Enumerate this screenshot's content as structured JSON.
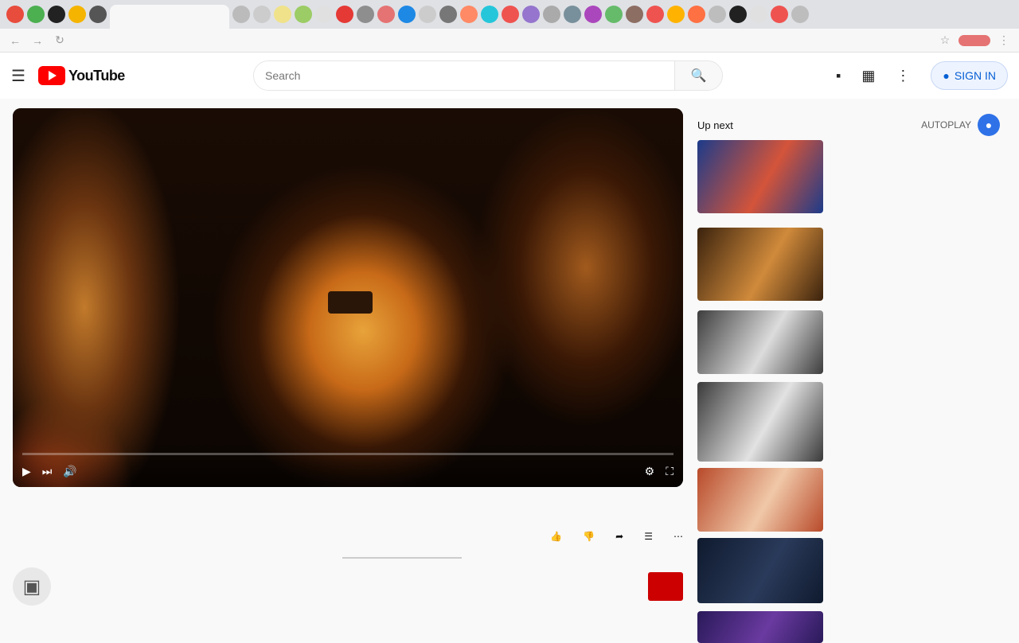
{
  "browser": {
    "tabs": [
      {
        "color": "#e84c3d"
      },
      {
        "color": "#4caf50"
      },
      {
        "color": "#222222"
      },
      {
        "color": "#f5b400"
      },
      {
        "color": "#555555"
      },
      {
        "color": "#bbbbbb"
      },
      {
        "color": "#cccccc"
      },
      {
        "color": "#f0e28a"
      },
      {
        "color": "#9ccc65"
      },
      {
        "color": "#e0e0e0"
      },
      {
        "color": "#e53935"
      },
      {
        "color": "#8e8e8e"
      },
      {
        "color": "#e57373"
      },
      {
        "color": "#1e88e5"
      },
      {
        "color": "#cccccc"
      },
      {
        "color": "#777777"
      },
      {
        "color": "#ff8a65"
      },
      {
        "color": "#26c6da"
      },
      {
        "color": "#ef5350"
      },
      {
        "color": "#9575cd"
      },
      {
        "color": "#aaaaaa"
      },
      {
        "color": "#78909c"
      },
      {
        "color": "#ab47bc"
      },
      {
        "color": "#66bb6a"
      },
      {
        "color": "#8d6e63"
      },
      {
        "color": "#ef5350"
      },
      {
        "color": "#ffb300"
      },
      {
        "color": "#ff7043"
      },
      {
        "color": "#bdbdbd"
      },
      {
        "color": "#212121"
      },
      {
        "color": "#e0e0e0"
      },
      {
        "color": "#ef5350"
      },
      {
        "color": "#bdbdbd"
      }
    ],
    "url": "",
    "back_icon": "arrow-left-icon",
    "forward_icon": "arrow-right-icon",
    "reload_icon": "reload-icon"
  },
  "header": {
    "logo_text": "YouTube",
    "search_placeholder": "Search",
    "sign_in_label": "SIGN IN"
  },
  "player": {
    "progress": 0.0,
    "time_display": ""
  },
  "video": {
    "title": "",
    "meta": "",
    "like_count": "",
    "dislike_count": "",
    "share_label": "",
    "save_label": ""
  },
  "channel": {
    "name": "",
    "subscribers": "",
    "subscribe_label": "",
    "description": ""
  },
  "sidebar": {
    "up_next_label": "Up next",
    "autoplay_label": "AUTOPLAY",
    "items": [
      {
        "title": "",
        "channel": "",
        "views": "",
        "thumb_colors": [
          "#1c3b8a",
          "#d4543a"
        ]
      },
      {
        "title": "",
        "channel": "",
        "views": "",
        "thumb_colors": [
          "#3a220d",
          "#d08a3b"
        ]
      },
      {
        "title": "",
        "channel": "",
        "views": "",
        "thumb_colors": [
          "#3d3d3d",
          "#dcdcdc"
        ]
      },
      {
        "title": "",
        "channel": "",
        "views": "",
        "thumb_colors": [
          "#3a3a3a",
          "#e2e2e2"
        ]
      },
      {
        "title": "",
        "channel": "",
        "views": "",
        "thumb_colors": [
          "#b84a2a",
          "#f0c8a8"
        ]
      },
      {
        "title": "",
        "channel": "",
        "views": "",
        "thumb_colors": [
          "#0f1a2e",
          "#2a3a5a"
        ]
      },
      {
        "title": "",
        "channel": "",
        "views": "",
        "thumb_colors": [
          "#2a1a5a",
          "#6a3aa0"
        ]
      }
    ]
  }
}
